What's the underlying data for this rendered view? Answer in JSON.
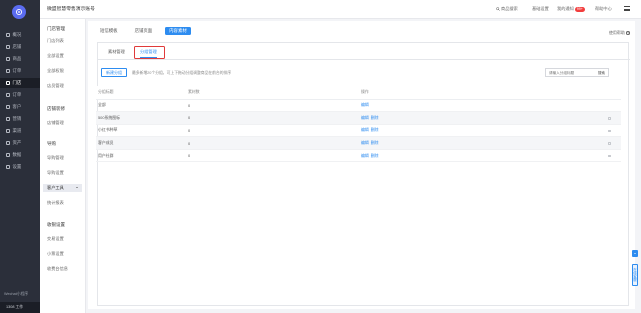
{
  "sidebar": {
    "items": [
      {
        "label": "概况",
        "icon": "home-icon"
      },
      {
        "label": "店铺",
        "icon": "shop-icon"
      },
      {
        "label": "商品",
        "icon": "goods-icon"
      },
      {
        "label": "订单",
        "icon": "order-icon"
      },
      {
        "label": "门店",
        "icon": "store-icon"
      },
      {
        "label": "订单",
        "icon": "list-icon"
      },
      {
        "label": "客户",
        "icon": "user-icon"
      },
      {
        "label": "营销",
        "icon": "marketing-icon"
      },
      {
        "label": "渠道",
        "icon": "channel-icon"
      },
      {
        "label": "资产",
        "icon": "asset-icon"
      },
      {
        "label": "数据",
        "icon": "data-icon"
      },
      {
        "label": "设置",
        "icon": "settings-icon"
      }
    ],
    "active_index": 4,
    "footer": "Wechat小程序",
    "user": "1308 工作"
  },
  "topbar": {
    "shop_name": "微盟智慧零售演示账号",
    "search": "商品搜索",
    "store": "基础设置",
    "messages": "我的通知",
    "message_count": "99+",
    "help": "帮助中心"
  },
  "subnav": {
    "group1": "门店管理",
    "group1_items": [
      "门店列表",
      "全部设置",
      "全部权限",
      "店员管理"
    ],
    "group2": "店铺装修",
    "group2_items": [
      "店铺管理"
    ],
    "group3": "导购",
    "group3_items": [
      "导购管理",
      "导购设置",
      "客户工具",
      "统计报表"
    ],
    "group4": "收银设置",
    "group4_items": [
      "交易设置",
      "小票设置",
      "收费台信息"
    ],
    "active": "客户工具"
  },
  "main": {
    "tabs": [
      "短信模板",
      "店铺页面",
      "内容素材"
    ],
    "active_tab": 2,
    "help_label": "使用帮助",
    "subtabs": [
      "素材管理",
      "分组管理"
    ],
    "active_subtab": 1,
    "new_button": "新建分组",
    "tip": "最多新增20个分组，可上下拖动分组调整商品在前台的排序",
    "search_placeholder": "请输入分组标题",
    "search_button": "搜索",
    "table": {
      "headers": [
        "分组标题",
        "素材数",
        "操作"
      ],
      "rows": [
        {
          "title": "全部",
          "count": "0",
          "actions": [
            "编辑"
          ],
          "checkbox": false
        },
        {
          "title": "500系统图标",
          "count": "0",
          "actions": [
            "编辑",
            "删除"
          ],
          "checkbox": true
        },
        {
          "title": "小红书种草",
          "count": "0",
          "actions": [
            "编辑",
            "删除"
          ],
          "checkbox": true
        },
        {
          "title": "客户成员",
          "count": "0",
          "actions": [
            "编辑",
            "删除"
          ],
          "checkbox": true
        },
        {
          "title": "用户社群",
          "count": "0",
          "actions": [
            "编辑",
            "删除"
          ],
          "checkbox": true
        }
      ]
    }
  },
  "floating": {
    "service": "在线客服"
  }
}
